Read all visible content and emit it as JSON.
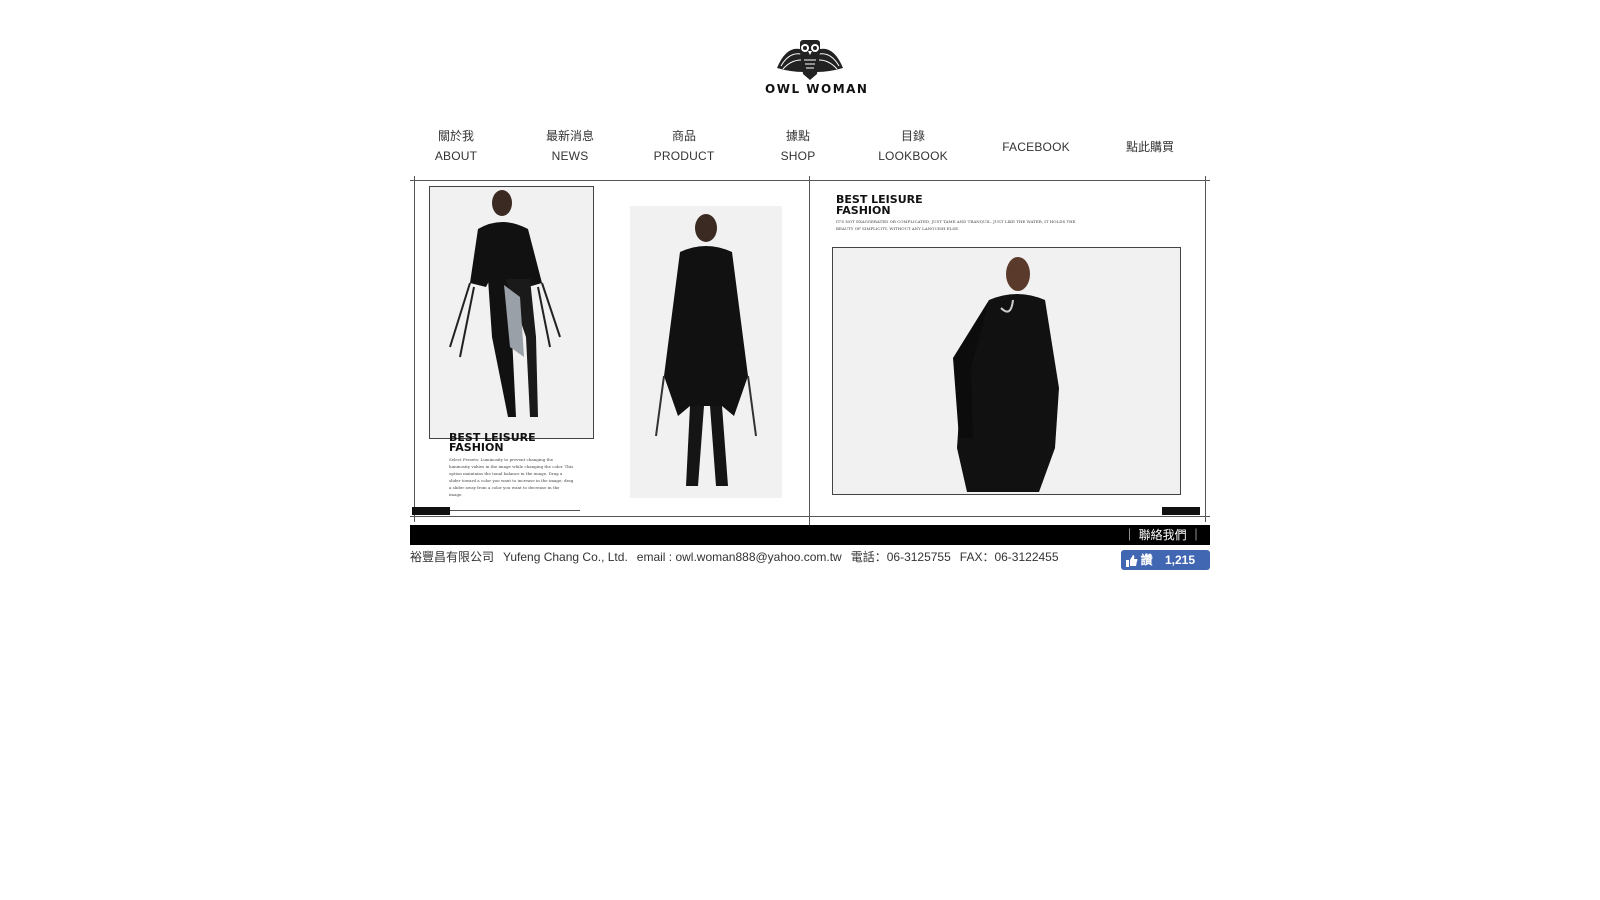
{
  "brand": {
    "name": "OWL WOMAN"
  },
  "nav": {
    "items": [
      {
        "zh": "關於我",
        "en": "ABOUT"
      },
      {
        "zh": "最新消息",
        "en": "NEWS"
      },
      {
        "zh": "商品",
        "en": "PRODUCT"
      },
      {
        "zh": "據點",
        "en": "SHOP"
      },
      {
        "zh": "目錄",
        "en": "LOOKBOOK"
      },
      {
        "label": "FACEBOOK"
      },
      {
        "label": "點此購買"
      }
    ]
  },
  "lookbook": {
    "left_title_1": "BEST  LEISURE",
    "left_title_2": "FASHION",
    "left_body": "Select Presets: Luminosity to prevent changing the luminosity values in the image while changing the color. This option maintains the tonal balance in the image. Drag a slider toward a color you want to increase in the image; drag a slider away from a color you want to decrease in the image.",
    "right_title_1": "BEST  LEISURE",
    "right_title_2": "FASHION",
    "right_body": "IT'S NOT EXAGGERATED OR COMPLICATED, JUST TAME AND TRANQUIL. JUST LIKE THE WATER, IT HOLDS THE BEAUTY OF SIMPLICITY, WITHOUT ANY LANGUISH ELSE."
  },
  "contact": {
    "label": "｜ 聯絡我們 ｜"
  },
  "footer": {
    "company": "裕豐昌有限公司",
    "company_en": "Yufeng Chang Co., Ltd.",
    "email": "email : owl.woman888@yahoo.com.tw",
    "phone": "電話：06-3125755",
    "fax": "FAX：06-3122455"
  },
  "facebook_like": {
    "label": "讚",
    "count": "1,215"
  },
  "colors": {
    "fb_blue": "#4267b2",
    "black": "#000000"
  }
}
